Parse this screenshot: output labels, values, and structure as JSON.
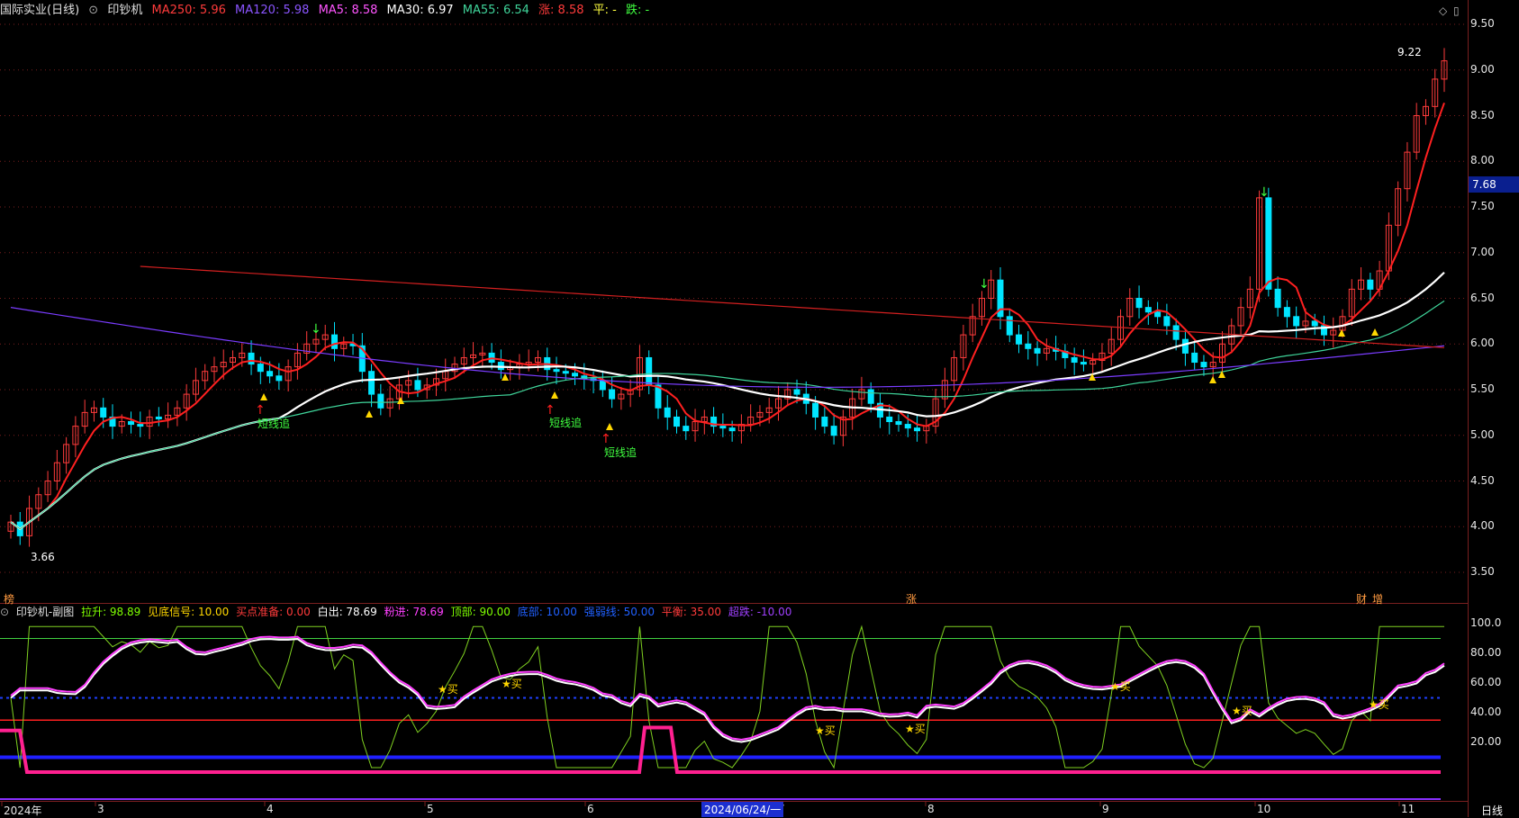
{
  "header": {
    "stock": "国际实业(日线)",
    "indicator": "印钞机",
    "ma250": "MA250: 5.96",
    "ma120": "MA120: 5.98",
    "ma5": "MA5: 8.58",
    "ma30": "MA30: 6.97",
    "ma55": "MA55: 6.54",
    "zhang": "涨: 8.58",
    "ping": "平: -",
    "die": "跌: -"
  },
  "subchart_header": {
    "title": "印钞机-副图",
    "lasheng": "拉升: 98.89",
    "jiandi": "见底信号: 10.00",
    "maidian": "买点准备: 0.00",
    "baichu": "白出: 78.69",
    "fenjin": "粉进: 78.69",
    "dingbu": "顶部: 90.00",
    "dibu": "底部: 10.00",
    "qiangruoxian": "强弱线: 50.00",
    "pingheng": "平衡: 35.00",
    "chaodie": "超跌: -10.00"
  },
  "price_axis": [
    "9.50",
    "9.00",
    "8.50",
    "8.00",
    "7.50",
    "7.00",
    "6.50",
    "6.00",
    "5.50",
    "5.00",
    "4.50",
    "4.00",
    "3.50"
  ],
  "current_price": "7.68",
  "sub_axis": [
    "100.0",
    "80.00",
    "60.00",
    "40.00",
    "20.00"
  ],
  "x_axis": {
    "ticks": [
      "2024年",
      "3",
      "4",
      "5",
      "6",
      "7",
      "8",
      "9",
      "10",
      "11"
    ],
    "selected": "2024/06/24/一",
    "period": "日线"
  },
  "annotations": {
    "high": "9.22",
    "low": "3.66",
    "signal_label": "短线追",
    "buy_label": "买",
    "bottom_marks": [
      "榜",
      "涨",
      "财",
      "增"
    ]
  },
  "colors": {
    "up": "#ff3b3b",
    "down": "#00e5ff",
    "ma5": "#ff2020",
    "ma120": "#7a3cff",
    "ma30": "#ffffff",
    "ma55": "#3fd49a",
    "ma250": "#d42020",
    "grid": "#7a1f1f"
  },
  "chart_data": {
    "type": "candlestick",
    "x_range": [
      "2024-02",
      "2024-11"
    ],
    "ylim": [
      3.4,
      9.6
    ],
    "ma250_start": 6.85,
    "ma250_end": 5.96,
    "ma120_start": 6.4,
    "ma120_end": 5.98,
    "closes": [
      4.05,
      3.9,
      4.2,
      4.35,
      4.5,
      4.7,
      4.9,
      5.1,
      5.25,
      5.3,
      5.2,
      5.1,
      5.15,
      5.12,
      5.1,
      5.2,
      5.18,
      5.22,
      5.3,
      5.45,
      5.6,
      5.7,
      5.75,
      5.8,
      5.85,
      5.9,
      5.78,
      5.7,
      5.65,
      5.6,
      5.75,
      5.9,
      6.0,
      6.05,
      6.1,
      5.95,
      6.0,
      5.98,
      5.7,
      5.45,
      5.3,
      5.4,
      5.55,
      5.6,
      5.5,
      5.55,
      5.62,
      5.7,
      5.78,
      5.85,
      5.88,
      5.9,
      5.8,
      5.72,
      5.75,
      5.78,
      5.8,
      5.85,
      5.72,
      5.7,
      5.68,
      5.65,
      5.62,
      5.6,
      5.5,
      5.4,
      5.45,
      5.5,
      5.85,
      5.55,
      5.3,
      5.2,
      5.1,
      5.05,
      5.15,
      5.2,
      5.1,
      5.08,
      5.05,
      5.12,
      5.2,
      5.25,
      5.3,
      5.4,
      5.5,
      5.45,
      5.35,
      5.2,
      5.1,
      5.0,
      5.2,
      5.4,
      5.5,
      5.35,
      5.2,
      5.15,
      5.12,
      5.08,
      5.05,
      5.1,
      5.4,
      5.6,
      5.85,
      6.1,
      6.3,
      6.5,
      6.7,
      6.3,
      6.1,
      6.0,
      5.95,
      5.9,
      5.95,
      5.92,
      5.85,
      5.8,
      5.78,
      5.82,
      5.9,
      6.05,
      6.3,
      6.5,
      6.4,
      6.35,
      6.3,
      6.2,
      6.05,
      5.9,
      5.8,
      5.75,
      5.8,
      6.0,
      6.2,
      6.4,
      6.6,
      7.6,
      6.6,
      6.4,
      6.3,
      6.2,
      6.25,
      6.2,
      6.1,
      6.15,
      6.3,
      6.6,
      6.7,
      6.6,
      6.8,
      7.3,
      7.7,
      8.1,
      8.5,
      8.6,
      8.9,
      9.1
    ],
    "indicator": {
      "ylim": [
        -10,
        110
      ],
      "lines": {
        "top": 90,
        "strength": 50,
        "balance": 35,
        "bottom": 10,
        "oversold": -10
      }
    }
  }
}
